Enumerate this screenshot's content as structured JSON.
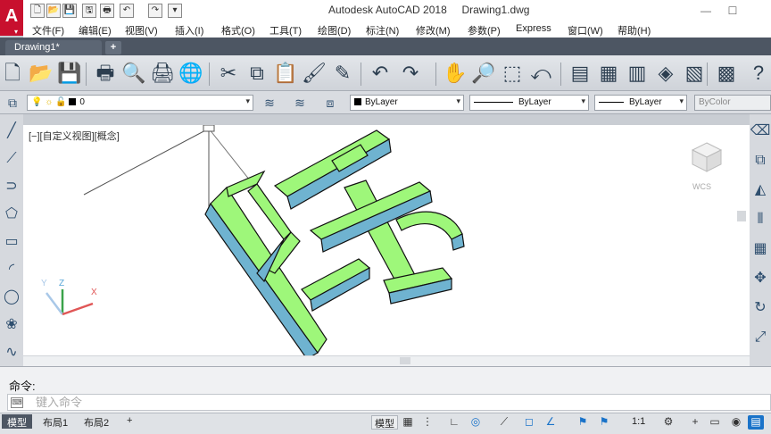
{
  "window": {
    "app_title": "Autodesk AutoCAD 2018",
    "file_name": "Drawing1.dwg",
    "minimize": "—",
    "maximize": "☐"
  },
  "app_logo": {
    "letter": "A",
    "sub": "▾"
  },
  "quick_access": [
    {
      "name": "new-icon",
      "glyph": "🗋"
    },
    {
      "name": "open-icon",
      "glyph": "📂"
    },
    {
      "name": "save-icon",
      "glyph": "💾"
    },
    {
      "name": "saveas-icon",
      "glyph": "🖫"
    },
    {
      "name": "print-icon",
      "glyph": "🖶"
    },
    {
      "name": "undo-icon",
      "glyph": "↶"
    },
    {
      "name": "redo-icon",
      "glyph": "↷"
    },
    {
      "name": "more-icon",
      "glyph": "▾"
    }
  ],
  "menu": [
    "文件(F)",
    "编辑(E)",
    "视图(V)",
    "插入(I)",
    "格式(O)",
    "工具(T)",
    "绘图(D)",
    "标注(N)",
    "修改(M)",
    "参数(P)",
    "Express",
    "窗口(W)",
    "帮助(H)"
  ],
  "tabs": {
    "doc_tab": "Drawing1*",
    "new_tab": "+"
  },
  "toolbar": [
    {
      "name": "new-icon",
      "glyph": "🗋"
    },
    {
      "name": "open-icon",
      "glyph": "📂"
    },
    {
      "name": "save-icon",
      "glyph": "💾"
    },
    {
      "name": "plot-icon",
      "glyph": "🖶"
    },
    {
      "name": "plot-preview-icon",
      "glyph": "🔍"
    },
    {
      "name": "publish-icon",
      "glyph": "🖨"
    },
    {
      "name": "3d-dwf-icon",
      "glyph": "🌐"
    },
    {
      "name": "cut-icon",
      "glyph": "✂"
    },
    {
      "name": "copy-icon",
      "glyph": "⧉"
    },
    {
      "name": "paste-icon",
      "glyph": "📋"
    },
    {
      "name": "match-properties-icon",
      "glyph": "🖌"
    },
    {
      "name": "block-editor-icon",
      "glyph": "✎"
    },
    {
      "name": "undo-icon",
      "glyph": "↶"
    },
    {
      "name": "redo-icon",
      "glyph": "↷"
    },
    {
      "name": "pan-icon",
      "glyph": "✋"
    },
    {
      "name": "zoom-realtime-icon",
      "glyph": "🔎"
    },
    {
      "name": "zoom-window-icon",
      "glyph": "⬚"
    },
    {
      "name": "zoom-previous-icon",
      "glyph": "⤺"
    },
    {
      "name": "properties-icon",
      "glyph": "▤"
    },
    {
      "name": "design-center-icon",
      "glyph": "▦"
    },
    {
      "name": "tool-palettes-icon",
      "glyph": "▥"
    },
    {
      "name": "sheet-set-icon",
      "glyph": "◈"
    },
    {
      "name": "markup-icon",
      "glyph": "▧"
    },
    {
      "name": "quickcalc-icon",
      "glyph": "▩"
    },
    {
      "name": "help-icon",
      "glyph": "?"
    }
  ],
  "properties": {
    "layer_value": "0",
    "color_value": "ByLayer",
    "linetype_value": "ByLayer",
    "lineweight_value": "ByLayer",
    "plotstyle_value": "ByColor"
  },
  "viewport": {
    "label": "[−][自定义视图][概念]",
    "wcs": "WCS"
  },
  "left_tools": [
    {
      "name": "line-icon",
      "glyph": "╱"
    },
    {
      "name": "construction-line-icon",
      "glyph": "⟋"
    },
    {
      "name": "polyline-icon",
      "glyph": "⊃"
    },
    {
      "name": "polygon-icon",
      "glyph": "⬠"
    },
    {
      "name": "rectangle-icon",
      "glyph": "▭"
    },
    {
      "name": "arc-icon",
      "glyph": "◜"
    },
    {
      "name": "circle-icon",
      "glyph": "◯"
    },
    {
      "name": "revcloud-icon",
      "glyph": "❀"
    },
    {
      "name": "spline-icon",
      "glyph": "∿"
    }
  ],
  "right_tools": [
    {
      "name": "erase-icon",
      "glyph": "⌫"
    },
    {
      "name": "copy-object-icon",
      "glyph": "⧉"
    },
    {
      "name": "mirror-icon",
      "glyph": "◭"
    },
    {
      "name": "offset-icon",
      "glyph": "⫴"
    },
    {
      "name": "array-icon",
      "glyph": "▦"
    },
    {
      "name": "move-icon",
      "glyph": "✥"
    },
    {
      "name": "rotate-icon",
      "glyph": "↻"
    },
    {
      "name": "scale-icon",
      "glyph": "⤢"
    }
  ],
  "command": {
    "history": "命令:",
    "placeholder": "键入命令",
    "icon": "⌨"
  },
  "layout_tabs": [
    "模型",
    "布局1",
    "布局2",
    "+"
  ],
  "status": {
    "model": "模型",
    "scale": "1:1",
    "buttons": [
      {
        "name": "grid-icon",
        "glyph": "▦"
      },
      {
        "name": "snap-icon",
        "glyph": "⋮"
      },
      {
        "name": "ortho-icon",
        "glyph": "∟"
      },
      {
        "name": "polar-icon",
        "glyph": "◎"
      },
      {
        "name": "isodraft-icon",
        "glyph": "⟋"
      },
      {
        "name": "osnap-icon",
        "glyph": "◻"
      },
      {
        "name": "object-track-icon",
        "glyph": "∠"
      },
      {
        "name": "annotation-visibility-icon",
        "glyph": "⚑"
      },
      {
        "name": "annotation-autoscale-icon",
        "glyph": "⚑"
      },
      {
        "name": "workspace-icon",
        "glyph": "⚙"
      },
      {
        "name": "annotation-monitor-icon",
        "glyph": "+"
      },
      {
        "name": "units-icon",
        "glyph": "▭"
      },
      {
        "name": "isolate-icon",
        "glyph": "◉"
      },
      {
        "name": "hardware-accel-icon",
        "glyph": "▤"
      }
    ]
  },
  "colors": {
    "logo_red": "#c8102e",
    "tab_bar": "#4d5663",
    "solid_green": "#9ef77a",
    "solid_side": "#6fb3d0",
    "accent_blue": "#1a73c9"
  }
}
